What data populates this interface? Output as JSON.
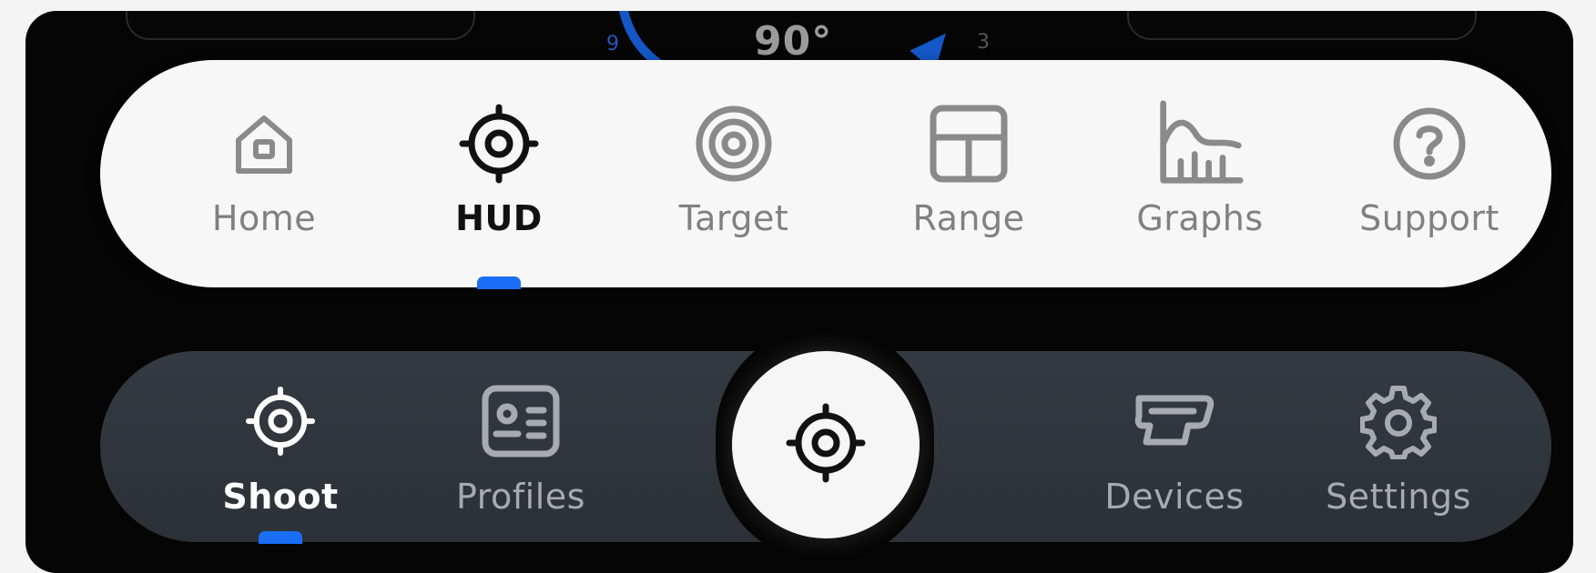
{
  "hud": {
    "angle": "90°",
    "tick_left": "9",
    "tick_right": "3"
  },
  "top_nav": {
    "items": [
      {
        "label": "Home",
        "icon": "home-icon",
        "active": false
      },
      {
        "label": "HUD",
        "icon": "crosshair-icon",
        "active": true
      },
      {
        "label": "Target",
        "icon": "target-icon",
        "active": false
      },
      {
        "label": "Range",
        "icon": "grid-icon",
        "active": false
      },
      {
        "label": "Graphs",
        "icon": "chart-icon",
        "active": false
      },
      {
        "label": "Support",
        "icon": "help-icon",
        "active": false
      }
    ]
  },
  "bottom_nav": {
    "items": [
      {
        "label": "Shoot",
        "icon": "crosshair-icon",
        "active": true
      },
      {
        "label": "Profiles",
        "icon": "profile-card-icon",
        "active": false
      },
      {
        "label": "Devices",
        "icon": "device-icon",
        "active": false
      },
      {
        "label": "Settings",
        "icon": "gear-icon",
        "active": false
      }
    ],
    "center_button_icon": "crosshair-icon"
  },
  "colors": {
    "accent": "#1a6ef5",
    "frame_bg": "#050505",
    "top_bar_bg": "#f7f7f7",
    "bottom_bar_bg": "#30353b",
    "inactive_top": "#808080",
    "inactive_bottom": "#a7abb0"
  }
}
